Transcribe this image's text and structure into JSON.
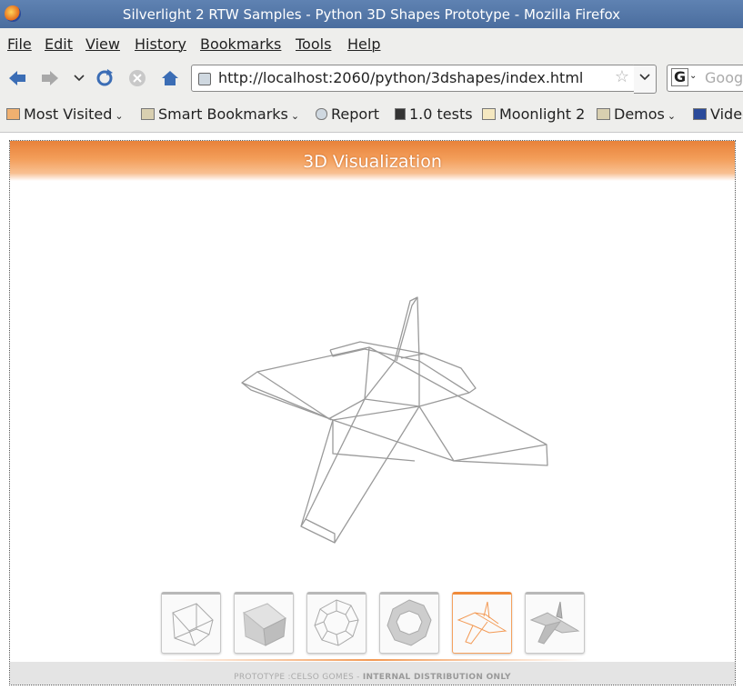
{
  "window": {
    "title": "Silverlight 2 RTW Samples - Python 3D Shapes Prototype - Mozilla Firefox"
  },
  "menu": [
    "File",
    "Edit",
    "View",
    "History",
    "Bookmarks",
    "Tools",
    "Help"
  ],
  "nav": {
    "url": "http://localhost:2060/python/3dshapes/index.html",
    "search_placeholder": "Goog",
    "search_engine": "G"
  },
  "bookmarks": [
    {
      "label": "Most Visited",
      "icon": "folder-icon",
      "dropdown": true
    },
    {
      "label": "Smart Bookmarks",
      "icon": "folder-icon",
      "dropdown": true
    },
    {
      "label": "Report",
      "icon": "page-icon",
      "dropdown": false
    },
    {
      "label": "1.0 tests",
      "icon": "test-icon",
      "dropdown": false
    },
    {
      "label": "Moonlight 2",
      "icon": "moon-icon",
      "dropdown": false
    },
    {
      "label": "Demos",
      "icon": "folder-icon",
      "dropdown": true
    },
    {
      "label": "Video",
      "icon": "video-icon",
      "dropdown": false
    }
  ],
  "app": {
    "banner_title": "3D Visualization",
    "footer_text": "PROTOTYPE :CELSO GOMES - ",
    "footer_bold": "INTERNAL DISTRIBUTION ONLY",
    "accent": "#f08a3a",
    "thumbnails": [
      {
        "name": "wire-cube",
        "selected": false
      },
      {
        "name": "solid-cube",
        "selected": false
      },
      {
        "name": "wire-torus",
        "selected": false
      },
      {
        "name": "solid-torus",
        "selected": false
      },
      {
        "name": "wire-ship",
        "selected": true
      },
      {
        "name": "solid-ship",
        "selected": false
      }
    ]
  }
}
